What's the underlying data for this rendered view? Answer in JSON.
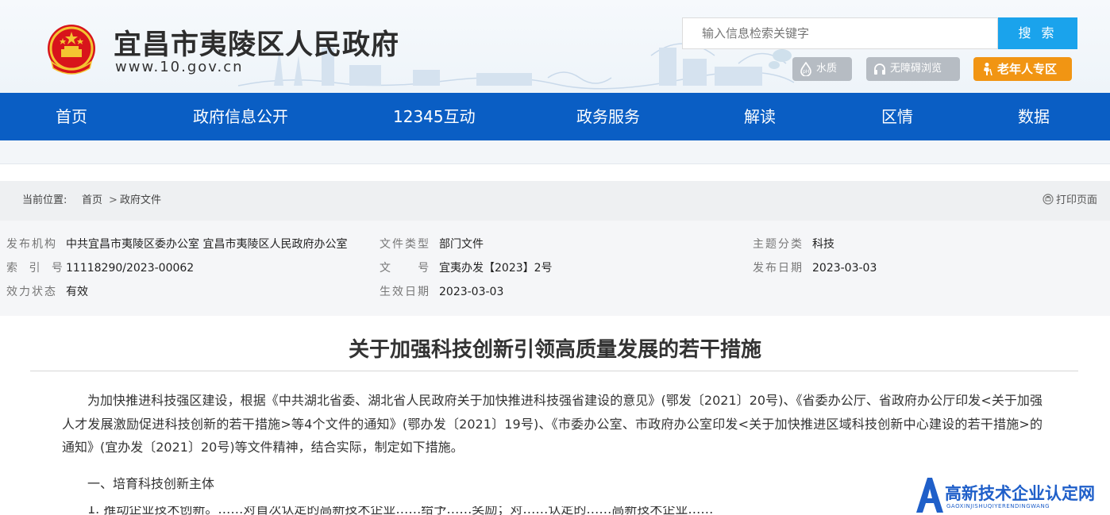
{
  "header": {
    "site_title": "宜昌市夷陵区人民政府",
    "site_url": "www.10.gov.cn",
    "search": {
      "placeholder": "输入信息检索关键字",
      "button_label": "搜 索"
    },
    "tools": [
      {
        "label": "水质",
        "icon": "water-drop-icon"
      },
      {
        "label": "无障碍浏览",
        "icon": "headphones-icon"
      },
      {
        "label": "老年人专区",
        "icon": "elder-person-icon"
      }
    ],
    "elder_color": "#f19513",
    "tool_color": "#b6bcc3",
    "search_color": "#1aa3ec"
  },
  "nav": {
    "color": "#0a5ec4",
    "items": [
      "首页",
      "政府信息公开",
      "12345互动",
      "政务服务",
      "解读",
      "区情",
      "数据"
    ]
  },
  "breadcrumb": {
    "label": "当前位置:",
    "home": "首页",
    "separator": ">",
    "current": "政府文件",
    "print_label": "打印页面"
  },
  "meta": {
    "publisher_label": "发布机构",
    "publisher": "中共宜昌市夷陵区委办公室 宜昌市夷陵区人民政府办公室",
    "doc_type_label": "文件类型",
    "doc_type": "部门文件",
    "topic_label": "主题分类",
    "topic": "科技",
    "index_label": "索 引 号",
    "index": "11118290/2023-00062",
    "doc_no_label": "文     号",
    "doc_no": "宜夷办发【2023】2号",
    "pub_date_label": "发布日期",
    "pub_date": "2023-03-03",
    "status_label": "效力状态",
    "status": "有效",
    "effective_label": "生效日期",
    "effective": "2023-03-03"
  },
  "article": {
    "title": "关于加强科技创新引领高质量发展的若干措施",
    "intro": "为加快推进科技强区建设，根据《中共湖北省委、湖北省人民政府关于加快推进科技强省建设的意见》(鄂发〔2021〕20号)、《省委办公厅、省政府办公厅印发<关于加强人才发展激励促进科技创新的若干措施>等4个文件的通知》(鄂办发〔2021〕19号)、《市委办公室、市政府办公室印发<关于加快推进区域科技创新中心建设的若干措施>的通知》(宜办发〔2021〕20号)等文件精神，结合实际，制定如下措施。",
    "section1": "一、培育科技创新主体",
    "next_line": "1. 推动企业技术创新。……对首次认定的高新技术企业……给予……奖励；对……认定的……高新技术企业……"
  },
  "watermark": {
    "cn": "高新技术企业认定网",
    "en": "GAOXINJISHUQIYERENDINGWANG"
  }
}
